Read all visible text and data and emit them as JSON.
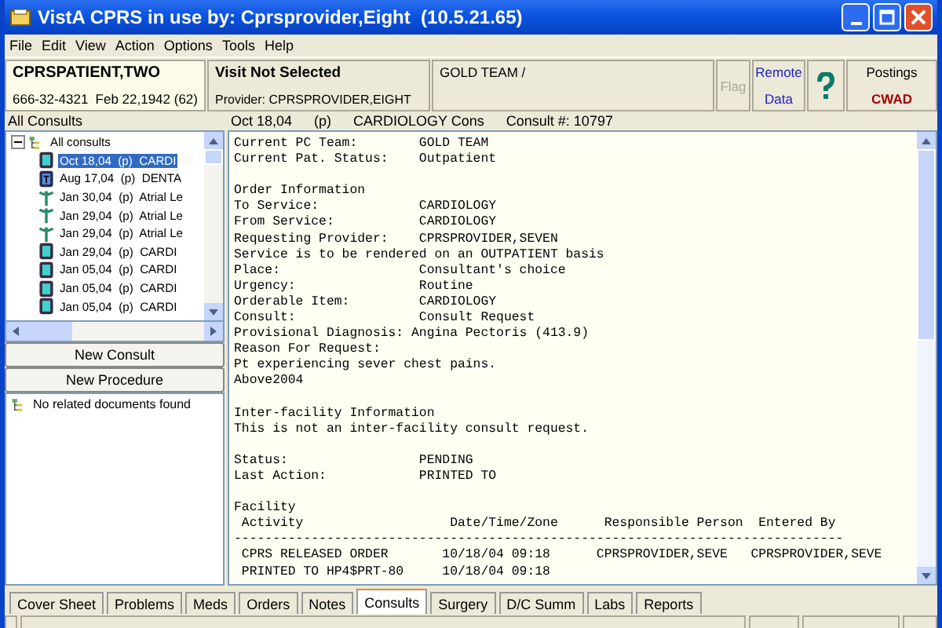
{
  "window": {
    "title": "VistA CPRS in use by: Cprsprovider,Eight  (10.5.21.65)"
  },
  "menu": [
    "File",
    "Edit",
    "View",
    "Action",
    "Options",
    "Tools",
    "Help"
  ],
  "patient": {
    "name": "CPRSPATIENT,TWO",
    "ssn": "666-32-4321",
    "dob": "Feb 22,1942 (62)"
  },
  "visit": {
    "title": "Visit Not Selected",
    "provider": "Provider:  CPRSPROVIDER,EIGHT"
  },
  "team": "GOLD TEAM /",
  "flag": {
    "label": "Flag",
    "disabled": true
  },
  "remote": {
    "line1": "Remote",
    "line2": "Data"
  },
  "postings": {
    "label": "Postings",
    "value": "CWAD"
  },
  "left": {
    "heading": "All Consults",
    "root": "All consults",
    "expanded": true,
    "items": [
      {
        "kind": "consult",
        "text": "Oct 18,04  (p)  CARDI",
        "selected": true
      },
      {
        "kind": "procedure",
        "text": "Aug 17,04  (p)  DENTA",
        "selected": false
      },
      {
        "kind": "caduceus",
        "text": "Jan 30,04  (p)  Atrial Le",
        "selected": false
      },
      {
        "kind": "caduceus",
        "text": "Jan 29,04  (p)  Atrial Le",
        "selected": false
      },
      {
        "kind": "caduceus",
        "text": "Jan 29,04  (p)  Atrial Le",
        "selected": false
      },
      {
        "kind": "consult",
        "text": "Jan 29,04  (p)  CARDI",
        "selected": false
      },
      {
        "kind": "consult",
        "text": "Jan 05,04  (p)  CARDI",
        "selected": false
      },
      {
        "kind": "consult",
        "text": "Jan 05,04  (p)  CARDI",
        "selected": false
      },
      {
        "kind": "consult",
        "text": "Jan 05,04  (p)  CARDI",
        "selected": false
      }
    ],
    "buttons": [
      "New Consult",
      "New Procedure"
    ],
    "related": "No related documents found"
  },
  "detail": {
    "date": "Oct 18,04",
    "status": "(p)",
    "service": "CARDIOLOGY Cons",
    "number": "Consult #: 10797",
    "blocks": [
      [
        "Current PC Team:        GOLD TEAM",
        "Current Pat. Status:    Outpatient"
      ],
      [
        "Order Information",
        "To Service:             CARDIOLOGY",
        "From Service:           CARDIOLOGY",
        "Requesting Provider:    CPRSPROVIDER,SEVEN",
        "Service is to be rendered on an OUTPATIENT basis",
        "Place:                  Consultant's choice",
        "Urgency:                Routine",
        "Orderable Item:         CARDIOLOGY",
        "Consult:                Consult Request",
        "Provisional Diagnosis: Angina Pectoris (413.9)",
        "Reason For Request:",
        "Pt experiencing sever chest pains.",
        "Above2004"
      ],
      [
        "Inter-facility Information",
        "This is not an inter-facility consult request."
      ],
      [
        "Status:                 PENDING",
        "Last Action:            PRINTED TO"
      ],
      [
        "Facility",
        " Activity                   Date/Time/Zone      Responsible Person  Entered By",
        "-------------------------------------------------------------------------------",
        " CPRS RELEASED ORDER       10/18/04 09:18      CPRSPROVIDER,SEVE   CPRSPROVIDER,SEVE",
        " PRINTED TO HP4$PRT-80     10/18/04 09:18"
      ]
    ]
  },
  "tabs": [
    {
      "label": "Cover Sheet",
      "selected": false
    },
    {
      "label": "Problems",
      "selected": false
    },
    {
      "label": "Meds",
      "selected": false
    },
    {
      "label": "Orders",
      "selected": false
    },
    {
      "label": "Notes",
      "selected": false
    },
    {
      "label": "Consults",
      "selected": true
    },
    {
      "label": "Surgery",
      "selected": false
    },
    {
      "label": "D/C Summ",
      "selected": false
    },
    {
      "label": "Labs",
      "selected": false
    },
    {
      "label": "Reports",
      "selected": false
    }
  ]
}
